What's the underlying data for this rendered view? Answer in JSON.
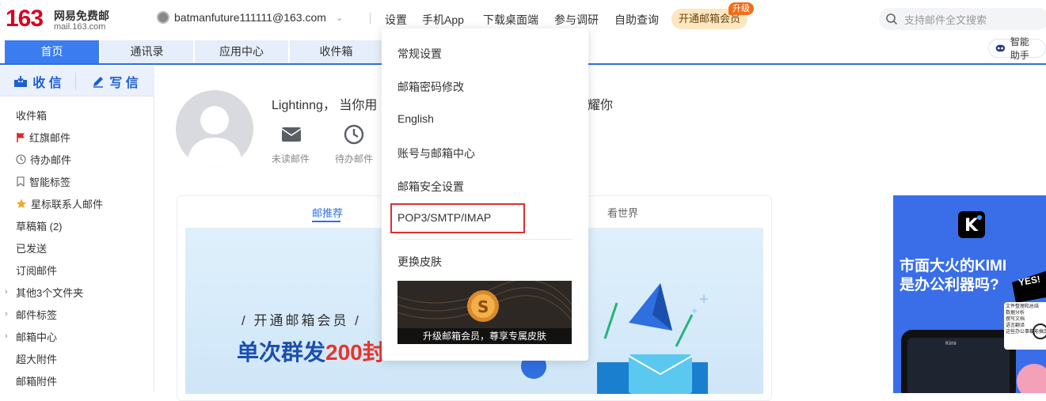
{
  "logo": {
    "number": "163",
    "name": "网易免费邮",
    "domain": "mail.163.com"
  },
  "account": {
    "email": "batmanfuture111111@163.com"
  },
  "top_nav": [
    "设置",
    "手机App",
    "下载桌面端",
    "参与调研",
    "自助查询"
  ],
  "vip": {
    "label": "开通邮箱会员",
    "badge": "升级"
  },
  "search": {
    "placeholder": "支持邮件全文搜索"
  },
  "tabs": [
    "首页",
    "通讯录",
    "应用中心",
    "收件箱"
  ],
  "assistant": {
    "label": "智能助手"
  },
  "compose": {
    "receive": "收 信",
    "write": "写 信"
  },
  "sidebar": {
    "items": [
      "收件箱",
      "红旗邮件",
      "待办邮件",
      "智能标签",
      "星标联系人邮件",
      "草稿箱 (2)",
      "已发送",
      "订阅邮件",
      "其他3个文件夹",
      "邮件标签",
      "邮箱中心",
      "超大附件",
      "邮箱附件"
    ]
  },
  "welcome": {
    "greeting_left": "Lightinng， 当你用",
    "greeting_right": "耀你",
    "unread_label": "未读邮件",
    "todo_label": "待办邮件"
  },
  "content_tabs": {
    "recommend": "邮推荐",
    "world": "看世界"
  },
  "banner": {
    "subtitle": "/ 开通邮箱会员 /",
    "title_prefix": "单次群发",
    "title_highlight": "200封"
  },
  "ad": {
    "line1": "市面大火的KIMI",
    "line2": "是办公利器吗?",
    "yes": "YES!",
    "notes": [
      "文件整理和总结",
      "数据分析",
      "撰写文档",
      "语言翻译",
      "这些办公事都能搞定!"
    ],
    "app_name": "Kimi"
  },
  "settings_menu": {
    "items": [
      "常规设置",
      "邮箱密码修改",
      "English",
      "账号与邮箱中心",
      "邮箱安全设置",
      "POP3/SMTP/IMAP",
      "更换皮肤"
    ],
    "skin_caption": "升级邮箱会员，尊享专属皮肤"
  },
  "colors": {
    "accent": "#3b7cf0",
    "brand_red": "#d8001f",
    "highlight_border": "#e02e2e"
  }
}
